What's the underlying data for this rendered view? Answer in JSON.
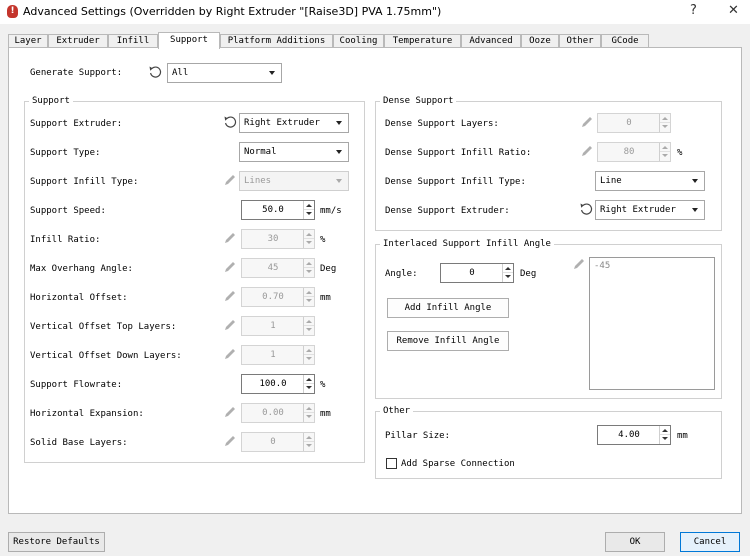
{
  "window": {
    "title": "Advanced Settings (Overridden by Right Extruder \"[Raise3D] PVA 1.75mm\")",
    "help": "?",
    "close": "✕"
  },
  "tabs": [
    {
      "label": "Layer"
    },
    {
      "label": "Extruder"
    },
    {
      "label": "Infill"
    },
    {
      "label": "Support"
    },
    {
      "label": "Platform Additions"
    },
    {
      "label": "Cooling"
    },
    {
      "label": "Temperature"
    },
    {
      "label": "Advanced"
    },
    {
      "label": "Ooze"
    },
    {
      "label": "Other"
    },
    {
      "label": "GCode"
    }
  ],
  "generate_support": {
    "label": "Generate Support:",
    "value": "All"
  },
  "support": {
    "title": "Support",
    "extruder": {
      "label": "Support Extruder:",
      "value": "Right Extruder"
    },
    "type": {
      "label": "Support Type:",
      "value": "Normal"
    },
    "infill_type": {
      "label": "Support Infill Type:",
      "value": "Lines"
    },
    "speed": {
      "label": "Support Speed:",
      "value": "50.0",
      "unit": "mm/s"
    },
    "infill_ratio": {
      "label": "Infill Ratio:",
      "value": "30",
      "unit": "%"
    },
    "max_overhang": {
      "label": "Max Overhang Angle:",
      "value": "45",
      "unit": "Deg"
    },
    "horizontal_offset": {
      "label": "Horizontal Offset:",
      "value": "0.70",
      "unit": "mm"
    },
    "vertical_top": {
      "label": "Vertical Offset Top Layers:",
      "value": "1"
    },
    "vertical_down": {
      "label": "Vertical Offset Down Layers:",
      "value": "1"
    },
    "flowrate": {
      "label": "Support Flowrate:",
      "value": "100.0",
      "unit": "%"
    },
    "horizontal_expansion": {
      "label": "Horizontal Expansion:",
      "value": "0.00",
      "unit": "mm"
    },
    "solid_base": {
      "label": "Solid Base Layers:",
      "value": "0"
    }
  },
  "dense": {
    "title": "Dense Support",
    "layers": {
      "label": "Dense Support Layers:",
      "value": "0"
    },
    "infill_ratio": {
      "label": "Dense Support Infill Ratio:",
      "value": "80",
      "unit": "%"
    },
    "infill_type": {
      "label": "Dense Support Infill Type:",
      "value": "Line"
    },
    "extruder": {
      "label": "Dense Support Extruder:",
      "value": "Right Extruder"
    }
  },
  "interlaced": {
    "title": "Interlaced Support Infill Angle",
    "angle": {
      "label": "Angle:",
      "value": "0",
      "unit": "Deg"
    },
    "add_button": "Add Infill Angle",
    "remove_button": "Remove Infill Angle",
    "list": [
      "-45"
    ]
  },
  "other": {
    "title": "Other",
    "pillar": {
      "label": "Pillar Size:",
      "value": "4.00",
      "unit": "mm"
    },
    "sparse": {
      "label": "Add Sparse Connection",
      "checked": false
    }
  },
  "footer": {
    "restore": "Restore Defaults",
    "ok": "OK",
    "cancel": "Cancel"
  },
  "colors": {
    "accent": "#0078d7",
    "title_icon": "#c4352c"
  }
}
